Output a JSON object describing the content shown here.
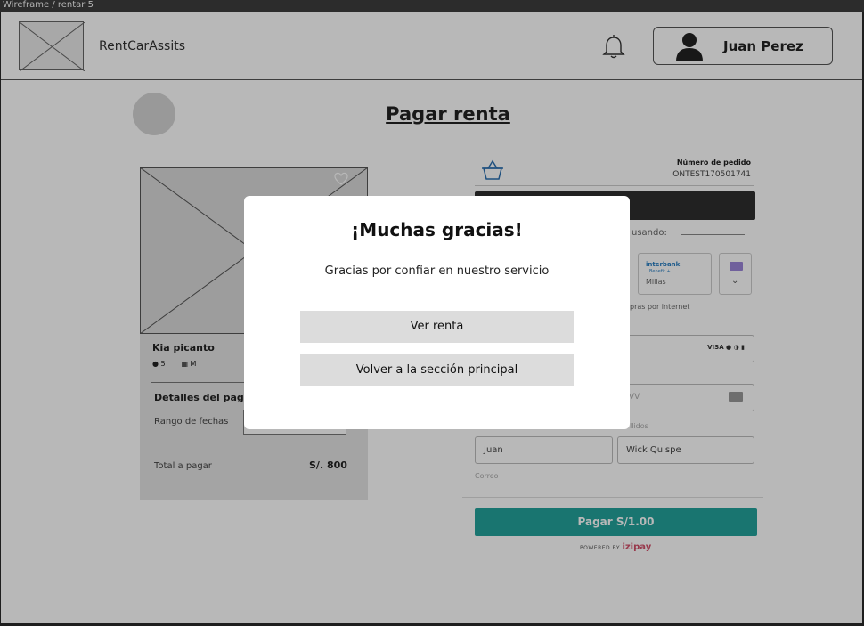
{
  "window": {
    "title": "Wireframe / rentar 5"
  },
  "header": {
    "brand": "RentCarAssits",
    "user_name": "Juan Perez"
  },
  "page": {
    "title": "Pagar renta"
  },
  "car_card": {
    "name": "Kia picanto",
    "seats": "5",
    "transmission": "M",
    "details_title": "Detalles del pago",
    "date_range_label": "Rango de fechas",
    "total_label": "Total a pagar",
    "total_value": "S/. 800"
  },
  "payment": {
    "order_label": "Número de pedido",
    "order_number": "ONTEST170501741",
    "using_label": "usando:",
    "interbank_brand": "interbank",
    "interbank_sub": "Benefit +",
    "millas_label": "Millas",
    "internet_label": "pras por internet",
    "card_brands": "VISA",
    "cvv_placeholder": "VV",
    "surnames_label": "llidos",
    "first_name": "Juan",
    "last_name": "Wick Quispe",
    "email_label": "Correo",
    "pay_button": "Pagar S/1.00",
    "powered_by": "POWERED BY",
    "powered_brand": "izipay"
  },
  "modal": {
    "title": "¡Muchas gracias!",
    "message": "Gracias por confiar en nuestro servicio",
    "view_rent_button": "Ver renta",
    "back_button": "Volver a la sección principal"
  },
  "colors": {
    "pay_button": "#23a39c",
    "overlay": "rgba(0,0,0,0.28)",
    "izipay": "#d34f6a"
  }
}
